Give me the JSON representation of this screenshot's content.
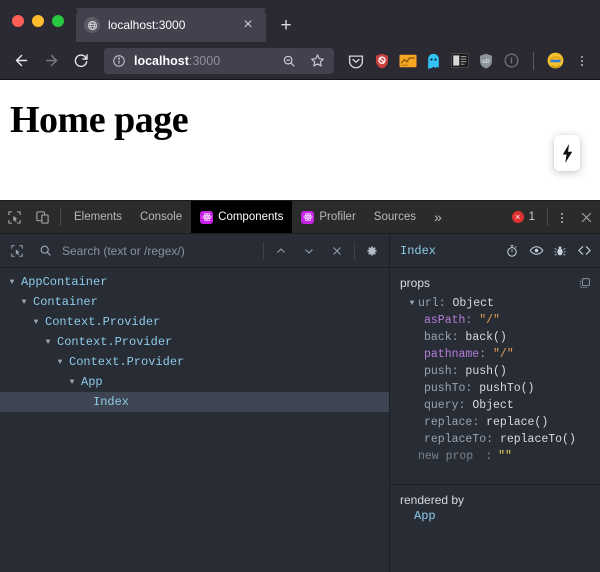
{
  "browser": {
    "window_controls": [
      "close",
      "minimize",
      "zoom"
    ],
    "tab": {
      "title": "localhost:3000",
      "favicon": "globe-icon",
      "close_label": "×"
    },
    "new_tab_label": "+",
    "nav": {
      "back": "back-icon",
      "forward": "forward-icon",
      "reload": "reload-icon"
    },
    "url": {
      "host": "localhost",
      "rest": ":3000",
      "full": "localhost:3000"
    },
    "urlbar_icons": [
      "zoom-search-icon",
      "bookmark-star-icon"
    ],
    "extensions": [
      "pocket-icon",
      "ublock-origin-icon",
      "orange-extension-icon",
      "ghostery-icon",
      "dark-reader-icon",
      "ublock-shield-icon",
      "page-info-icon"
    ],
    "account_icon": "profile-avatar-icon",
    "menu_icon": "kebab-menu-icon"
  },
  "page": {
    "heading": "Home page",
    "dev_indicator": "lightning-bolt-icon"
  },
  "devtools": {
    "toolbar_icons": [
      "inspect-element-icon",
      "device-toolbar-icon"
    ],
    "tabs": [
      {
        "label": "Elements",
        "active": false,
        "icon": null
      },
      {
        "label": "Console",
        "active": false,
        "icon": null
      },
      {
        "label": "Components",
        "active": true,
        "icon": "react-logo-icon"
      },
      {
        "label": "Profiler",
        "active": false,
        "icon": "react-logo-icon"
      },
      {
        "label": "Sources",
        "active": false,
        "icon": null
      }
    ],
    "overflow_label": "»",
    "errors": {
      "count": "1",
      "icon": "error-circle-icon"
    },
    "more_label": "kebab-menu-icon",
    "close_label": "×",
    "search": {
      "placeholder": "Search (text or /regex/)",
      "value": "",
      "prev_label": "⌃",
      "next_label": "⌄",
      "clear_label": "×",
      "settings_icon": "gear-icon"
    },
    "tree": [
      {
        "label": "AppContainer",
        "depth": 0,
        "expanded": true,
        "selected": false
      },
      {
        "label": "Container",
        "depth": 1,
        "expanded": true,
        "selected": false
      },
      {
        "label": "Context.Provider",
        "depth": 2,
        "expanded": true,
        "selected": false
      },
      {
        "label": "Context.Provider",
        "depth": 3,
        "expanded": true,
        "selected": false
      },
      {
        "label": "Context.Provider",
        "depth": 4,
        "expanded": true,
        "selected": false
      },
      {
        "label": "App",
        "depth": 5,
        "expanded": true,
        "selected": false
      },
      {
        "label": "Index",
        "depth": 6,
        "expanded": false,
        "selected": true
      }
    ],
    "inspector": {
      "title": "Index",
      "icons": [
        "timer-icon",
        "eye-icon",
        "bug-icon",
        "code-icon"
      ],
      "props_label": "props",
      "copy_icon": "copy-icon",
      "props": [
        {
          "key": "url",
          "value": "Object",
          "kind": "object",
          "indent": 1,
          "expanded": true
        },
        {
          "key": "asPath",
          "value": "\"/\"",
          "kind": "string",
          "indent": 2
        },
        {
          "key": "back",
          "value": "back()",
          "kind": "fn",
          "indent": 2
        },
        {
          "key": "pathname",
          "value": "\"/\"",
          "kind": "string",
          "indent": 2
        },
        {
          "key": "push",
          "value": "push()",
          "kind": "fn",
          "indent": 2
        },
        {
          "key": "pushTo",
          "value": "pushTo()",
          "kind": "fn",
          "indent": 2
        },
        {
          "key": "query",
          "value": "Object",
          "kind": "object",
          "indent": 2
        },
        {
          "key": "replace",
          "value": "replace()",
          "kind": "fn",
          "indent": 2
        },
        {
          "key": "replaceTo",
          "value": "replaceTo()",
          "kind": "fn",
          "indent": 2
        }
      ],
      "new_prop": {
        "label": "new prop",
        "separator": ":",
        "value": "\"\""
      },
      "rendered_by": {
        "label": "rendered by",
        "items": [
          "App"
        ]
      }
    }
  },
  "colors": {
    "accent_react": "#c724e8",
    "component_blue": "#8ecbea",
    "string_orange": "#e5a254",
    "key_purple": "#b57edc",
    "error_red": "#e03131",
    "devtools_bg": "#282c34",
    "chrome_bg": "#2b2a33"
  }
}
